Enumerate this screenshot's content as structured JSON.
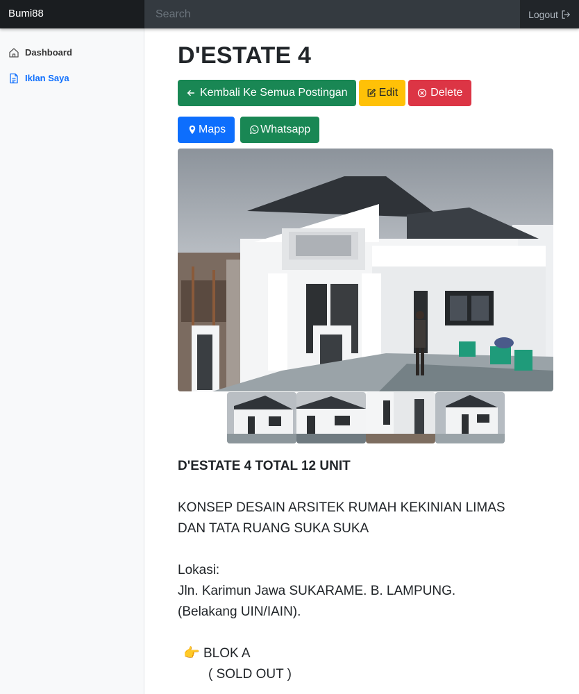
{
  "navbar": {
    "brand": "Bumi88",
    "search_placeholder": "Search",
    "logout_label": "Logout"
  },
  "sidebar": {
    "items": [
      {
        "label": "Dashboard",
        "icon": "home-icon",
        "active": false
      },
      {
        "label": "Iklan Saya",
        "icon": "file-text-icon",
        "active": true
      }
    ]
  },
  "post": {
    "title": "D'ESTATE 4",
    "buttons": {
      "back": "Kembali Ke Semua Postingan",
      "edit": "Edit",
      "delete": "Delete",
      "maps": "Maps",
      "whatsapp": "Whatsapp"
    },
    "description": {
      "headline": "D'ESTATE 4 TOTAL 12 UNIT",
      "concept_line1": "KONSEP DESAIN ARSITEK RUMAH KEKINIAN LIMAS",
      "concept_line2": "DAN TATA RUANG SUKA SUKA",
      "location_label": "Lokasi:",
      "location_line1": "Jln. Karimun Jawa SUKARAME. B. LAMPUNG.",
      "location_line2": "(Belakang UIN/IAIN).",
      "block_emoji": "👉",
      "block_label": "BLOK A",
      "block_status": "( SOLD OUT )"
    }
  },
  "colors": {
    "navbar": "#212529",
    "primary": "#0d6efd",
    "success": "#198754",
    "warning": "#ffc107",
    "danger": "#dc3545"
  }
}
